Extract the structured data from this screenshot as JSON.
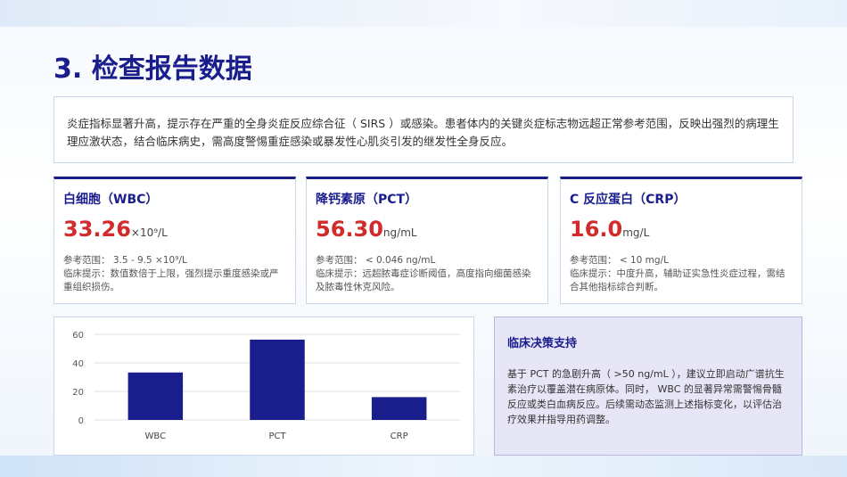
{
  "page": {
    "title": "3. 检查报告数据",
    "summary": "炎症指标显著升高，提示存在严重的全身炎症反应综合征（ SIRS ）或感染。患者体内的关键炎症标志物远超正常参考范围，反映出强烈的病理生理应激状态，结合临床病史，需高度警惕重症感染或暴发性心肌炎引发的继发性全身反应。"
  },
  "cards": [
    {
      "title": "白细胞（WBC）",
      "value": "33.26",
      "unit": "×10⁹/L",
      "reference": "参考范围： 3.5 - 9.5 ×10⁹/L",
      "hint": "临床提示：数值数倍于上限，强烈提示重度感染或严重组织损伤。"
    },
    {
      "title": "降钙素原（PCT）",
      "value": "56.30",
      "unit": "ng/mL",
      "reference": "参考范围： < 0.046 ng/mL",
      "hint": "临床提示：远超脓毒症诊断阈值，高度指向细菌感染及脓毒性休克风险。"
    },
    {
      "title": "C 反应蛋白（CRP）",
      "value": "16.0",
      "unit": "mg/L",
      "reference": "参考范围： < 10 mg/L",
      "hint": "临床提示：中度升高，辅助证实急性炎症过程，需结合其他指标综合判断。"
    }
  ],
  "decision": {
    "title": "临床决策支持",
    "text": "基于 PCT 的急剧升高（ >50 ng/mL ），建议立即启动广谱抗生素治疗以覆盖潜在病原体。同时， WBC 的显著异常需警惕骨髓反应或类白血病反应。后续需动态监测上述指标变化，以评估治疗效果并指导用药调整。"
  },
  "colors": {
    "accent": "#1a1e8c",
    "value_red": "#d22b2b",
    "bar": "#1a1e8c"
  },
  "chart_data": {
    "type": "bar",
    "categories": [
      "WBC",
      "PCT",
      "CRP"
    ],
    "values": [
      33.26,
      56.3,
      16.0
    ],
    "ylim": [
      0,
      60
    ],
    "yticks": [
      0,
      20,
      40,
      60
    ],
    "grid": true,
    "title": "",
    "xlabel": "",
    "ylabel": ""
  }
}
